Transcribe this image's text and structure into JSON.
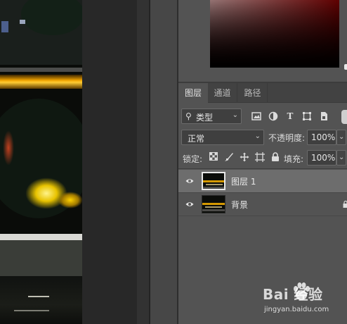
{
  "panels": {
    "tabs": [
      {
        "label": "图层",
        "active": true
      },
      {
        "label": "通道",
        "active": false
      },
      {
        "label": "路径",
        "active": false
      }
    ]
  },
  "filter": {
    "kind_label": "类型",
    "icons": [
      "image-filter-icon",
      "adjustment-filter-icon",
      "type-filter-icon",
      "shape-filter-icon",
      "smart-object-filter-icon"
    ]
  },
  "blend": {
    "mode": "正常",
    "opacity_label": "不透明度:",
    "opacity_value": "100%"
  },
  "lock": {
    "label": "锁定:",
    "icons": [
      "lock-transparent-icon",
      "lock-image-icon",
      "lock-position-icon",
      "lock-artboard-icon",
      "lock-all-icon"
    ],
    "fill_label": "填充:",
    "fill_value": "100%"
  },
  "layers": [
    {
      "name": "图层 1",
      "visible": true,
      "selected": true,
      "locked": false
    },
    {
      "name": "背景",
      "visible": true,
      "selected": false,
      "locked": true
    }
  ],
  "watermark": {
    "brand": "Bai  经验",
    "url": "jingyan.baidu.com"
  },
  "colors": {
    "panel_bg": "#535353",
    "selected_row": "#6d6d6d",
    "tab_bar": "#424242"
  }
}
